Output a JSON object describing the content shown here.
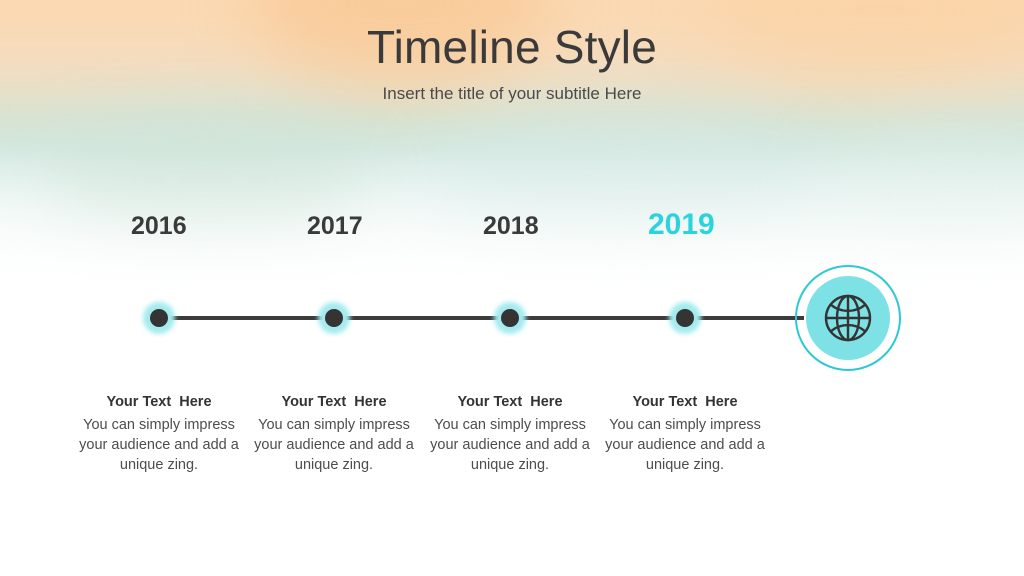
{
  "header": {
    "title": "Timeline Style",
    "subtitle": "Insert the title of your subtitle Here"
  },
  "colors": {
    "accent_cyan": "#2bd4dd",
    "node_dark": "#343434",
    "halo_cyan": "#a4ebee",
    "globe_fill": "#7ee1e6",
    "globe_ring": "#2cc8d6",
    "line_dark": "#3c3c3c",
    "text_dark": "#3a3a3a",
    "bg_peach": "#fbd7af",
    "bg_mint": "#d6e3d3"
  },
  "timeline": {
    "milestones": [
      {
        "year": "2016",
        "highlighted": false,
        "title": "Your Text  Here",
        "body": "You can simply impress your audience and add a unique zing."
      },
      {
        "year": "2017",
        "highlighted": false,
        "title": "Your Text  Here",
        "body": "You can simply impress your audience and add a unique zing."
      },
      {
        "year": "2018",
        "highlighted": false,
        "title": "Your Text  Here",
        "body": "You can simply impress your audience and add a unique zing."
      },
      {
        "year": "2019",
        "highlighted": true,
        "title": "Your Text  Here",
        "body": "You can simply impress your audience and add a unique zing."
      }
    ],
    "end_badge": {
      "icon": "globe-icon"
    }
  }
}
